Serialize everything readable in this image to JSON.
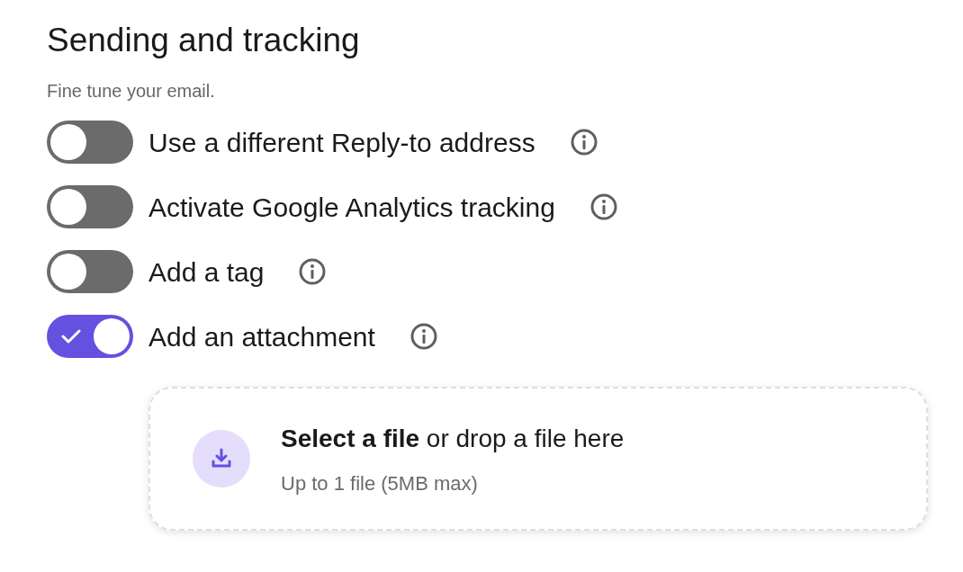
{
  "title": "Sending and tracking",
  "subtitle": "Fine tune your email.",
  "options": [
    {
      "label": "Use a different Reply-to address",
      "on": false
    },
    {
      "label": "Activate Google Analytics tracking",
      "on": false
    },
    {
      "label": "Add a tag",
      "on": false
    },
    {
      "label": "Add an attachment",
      "on": true
    }
  ],
  "dropzone": {
    "text": "**Select a file** or drop a file here",
    "hint": "Up to 1 file (5MB max)"
  }
}
